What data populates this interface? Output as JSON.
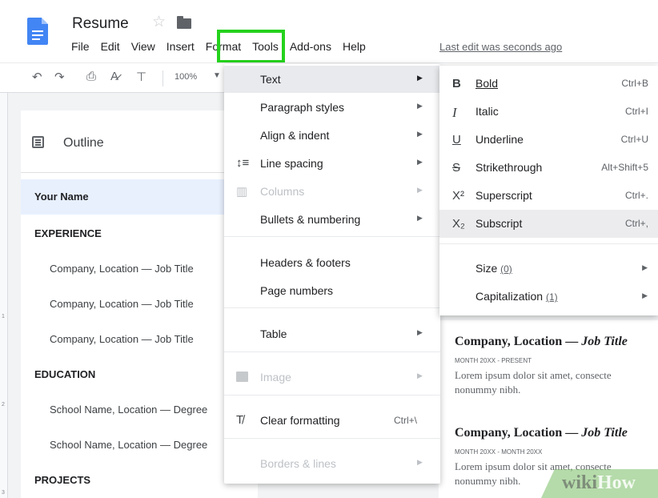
{
  "app": {
    "doc_title": "Resume",
    "last_edit": "Last edit was seconds ago"
  },
  "menubar": [
    "File",
    "Edit",
    "View",
    "Insert",
    "Format",
    "Tools",
    "Add-ons",
    "Help"
  ],
  "toolbar": {
    "zoom": "100%"
  },
  "colors": {
    "highlight": "#25d21d",
    "selected_outline": "#e8f0fe",
    "doc_blue": "#4285f4"
  },
  "icons": {
    "undo": "undo-icon",
    "redo": "redo-icon",
    "print": "print-icon",
    "spellcheck": "spellcheck-icon",
    "paint_format": "paint-format-icon",
    "star": "star-icon",
    "folder": "folder-icon",
    "outline": "outline-icon"
  },
  "outline": {
    "title": "Outline",
    "items": [
      {
        "text": "Your Name",
        "level": 1,
        "selected": true
      },
      {
        "text": "EXPERIENCE",
        "level": 1
      },
      {
        "text": "Company, Location — Job Title",
        "level": 2
      },
      {
        "text": "Company, Location — Job Title",
        "level": 2
      },
      {
        "text": "Company, Location — Job Title",
        "level": 2
      },
      {
        "text": "EDUCATION",
        "level": 1
      },
      {
        "text": "School Name, Location — Degree",
        "level": 2
      },
      {
        "text": "School Name, Location — Degree",
        "level": 2
      },
      {
        "text": "PROJECTS",
        "level": 1
      }
    ]
  },
  "format_menu": {
    "text": "Text",
    "paragraph_styles": "Paragraph styles",
    "align_indent": "Align & indent",
    "line_spacing": "Line spacing",
    "columns": "Columns",
    "bullets": "Bullets & numbering",
    "headers_footers": "Headers & footers",
    "page_numbers": "Page numbers",
    "table": "Table",
    "image": "Image",
    "clear_formatting": "Clear formatting",
    "clear_formatting_shortcut": "Ctrl+\\",
    "borders_lines": "Borders & lines"
  },
  "text_submenu": {
    "bold": {
      "label": "Bold",
      "shortcut": "Ctrl+B",
      "glyph": "B"
    },
    "italic": {
      "label": "Italic",
      "shortcut": "Ctrl+I",
      "glyph": "I"
    },
    "underline": {
      "label": "Underline",
      "shortcut": "Ctrl+U",
      "glyph": "U"
    },
    "strikethrough": {
      "label": "Strikethrough",
      "shortcut": "Alt+Shift+5",
      "glyph": "S"
    },
    "superscript": {
      "label": "Superscript",
      "shortcut": "Ctrl+.",
      "glyph": "X²"
    },
    "subscript": {
      "label": "Subscript",
      "shortcut": "Ctrl+,",
      "glyph": "X₂"
    },
    "size": {
      "label": "Size",
      "paren": "(0)"
    },
    "capitalization": {
      "label": "Capitalization",
      "paren": "(1)"
    }
  },
  "document": {
    "heading1": "Company, Location — ",
    "heading1_italic": "Job Title",
    "date1": "MONTH 20XX - PRESENT",
    "para1_line1": "Lorem ipsum dolor sit amet, consecte",
    "para1_line2": "nonummy nibh.",
    "heading2": "Company, Location — ",
    "heading2_italic": "Job Title",
    "date2": "MONTH 20XX - MONTH 20XX",
    "para2_line1": "Lorem ipsum dolor sit amet, consecte",
    "para2_line2": "nonummy nibh."
  },
  "watermark": {
    "part1": "wiki",
    "part2": "How"
  }
}
